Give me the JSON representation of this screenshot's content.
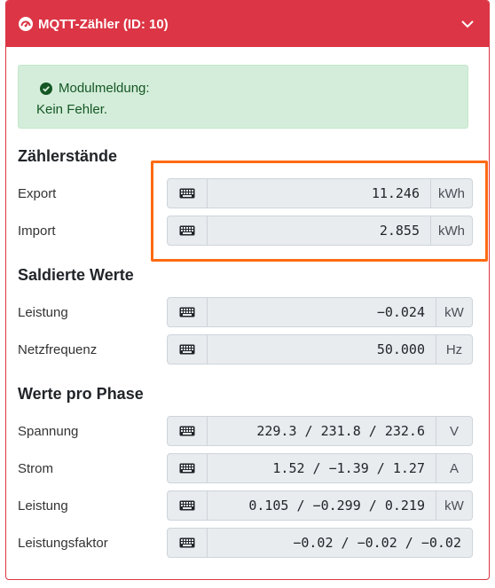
{
  "header": {
    "title": "MQTT-Zähler (ID: 10)"
  },
  "alert": {
    "title": "Modulmeldung:",
    "message": "Kein Fehler."
  },
  "sections": {
    "counters": "Zählerstände",
    "balanced": "Saldierte Werte",
    "phase": "Werte pro Phase"
  },
  "rows": {
    "export": {
      "label": "Export",
      "value": "11.246",
      "unit": "kWh"
    },
    "import": {
      "label": "Import",
      "value": "2.855",
      "unit": "kWh"
    },
    "power": {
      "label": "Leistung",
      "value": "−0.024",
      "unit": "kW"
    },
    "frequency": {
      "label": "Netzfrequenz",
      "value": "50.000",
      "unit": "Hz"
    },
    "voltage": {
      "label": "Spannung",
      "value": "229.3 / 231.8 / 232.6",
      "unit": "V"
    },
    "current": {
      "label": "Strom",
      "value": "1.52 / −1.39 / 1.27",
      "unit": "A"
    },
    "phase_power": {
      "label": "Leistung",
      "value": "0.105 / −0.299 / 0.219",
      "unit": "kW"
    },
    "power_factor": {
      "label": "Leistungsfaktor",
      "value": "−0.02 / −0.02 / −0.02",
      "unit": ""
    }
  },
  "colors": {
    "header": "#dc3545",
    "alert_bg": "#d4edda",
    "highlight": "#ff6a13"
  },
  "icons": {
    "header": "gauge-icon",
    "alert": "check-circle-icon",
    "field": "keyboard-icon",
    "toggle": "chevron-down-icon"
  }
}
